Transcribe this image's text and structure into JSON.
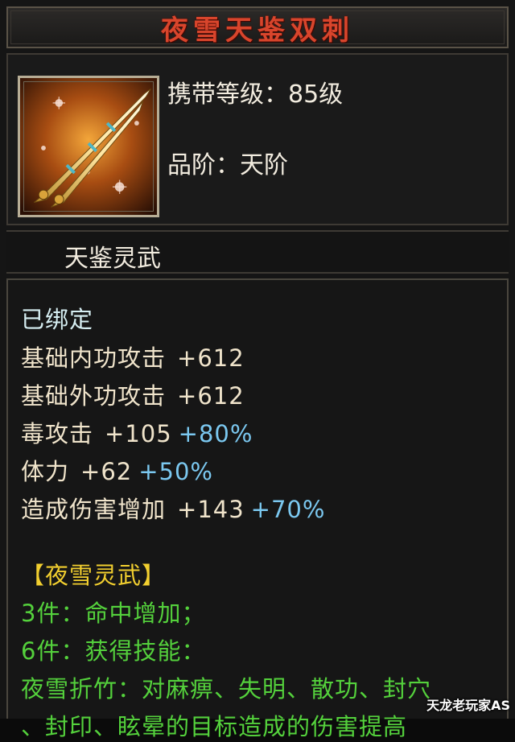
{
  "item": {
    "name": "夜雪天鉴双刺",
    "icon": "twin-daggers-icon",
    "carry_level_label": "携带等级：",
    "carry_level_value": "85级",
    "grade_label": "品阶：",
    "grade_value": "天阶",
    "soul_name": "天鉴灵武"
  },
  "stats": {
    "bound": "已绑定",
    "lines": [
      {
        "name": "基础内功攻击",
        "value": "+612",
        "percent": ""
      },
      {
        "name": "基础外功攻击",
        "value": "+612",
        "percent": ""
      },
      {
        "name": "毒攻击",
        "value": "+105",
        "percent": "+80%"
      },
      {
        "name": "体力",
        "value": "+62",
        "percent": "+50%"
      },
      {
        "name": "造成伤害增加",
        "value": "+143",
        "percent": "+70%"
      }
    ]
  },
  "set": {
    "title": "【夜雪灵武】",
    "piece3": "3件：命中增加；",
    "piece6": "6件：获得技能：",
    "skill_desc": "夜雪折竹：对麻痹、失明、散功、封穴",
    "skill_desc_cont": "、封印、眩晕的目标造成的伤害提高"
  },
  "watermark": "天龙老玩家AS",
  "colors": {
    "title_red": "#d8452c",
    "percent_blue": "#7bc8f0",
    "set_yellow": "#f2cf2f",
    "set_green": "#54d13c"
  }
}
